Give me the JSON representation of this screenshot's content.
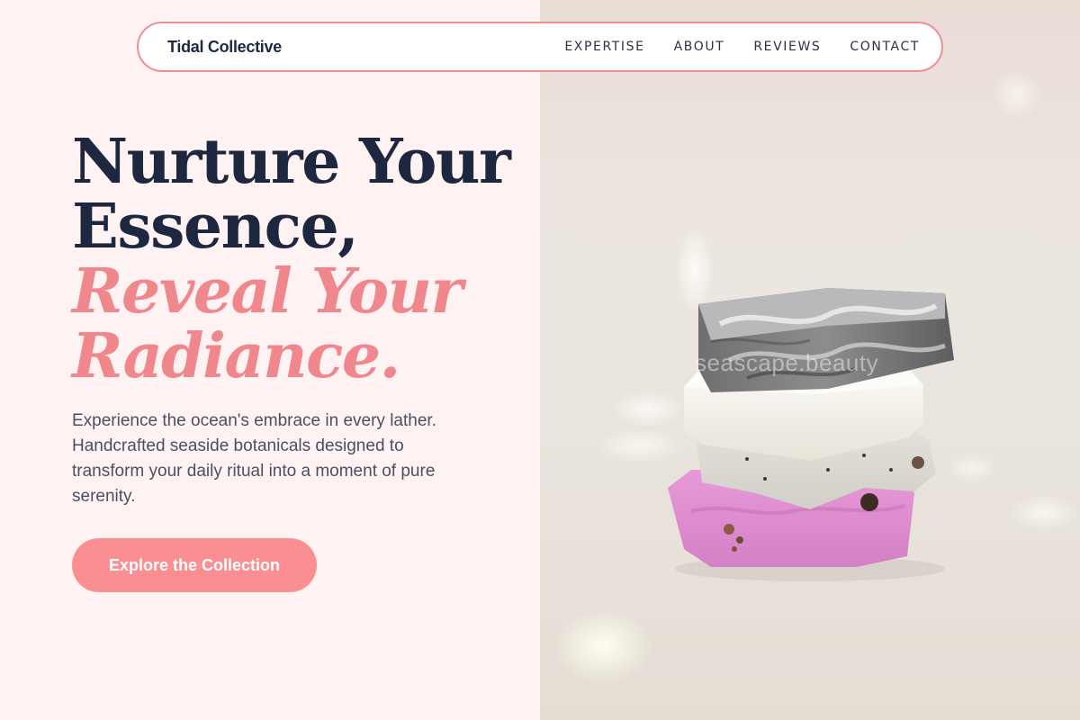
{
  "nav": {
    "brand": "Tidal Collective",
    "links": [
      "EXPERTISE",
      "ABOUT",
      "REVIEWS",
      "CONTACT"
    ]
  },
  "hero": {
    "title_line1": "Nurture Your",
    "title_line2": "Essence,",
    "accent_line1": "Reveal Your",
    "accent_line2": "Radiance.",
    "description": "Experience the ocean's embrace in every lather. Handcrafted seaside botanicals designed to transform your daily ritual into a moment of pure serenity.",
    "cta_label": "Explore the Collection"
  },
  "image": {
    "watermark": "seascape.beauty"
  },
  "colors": {
    "page_background": "#fff2f2",
    "navy": "#1d2740",
    "coral_accent": "#f0878c",
    "button": "#f98f93",
    "nav_border": "#ee8e92"
  }
}
